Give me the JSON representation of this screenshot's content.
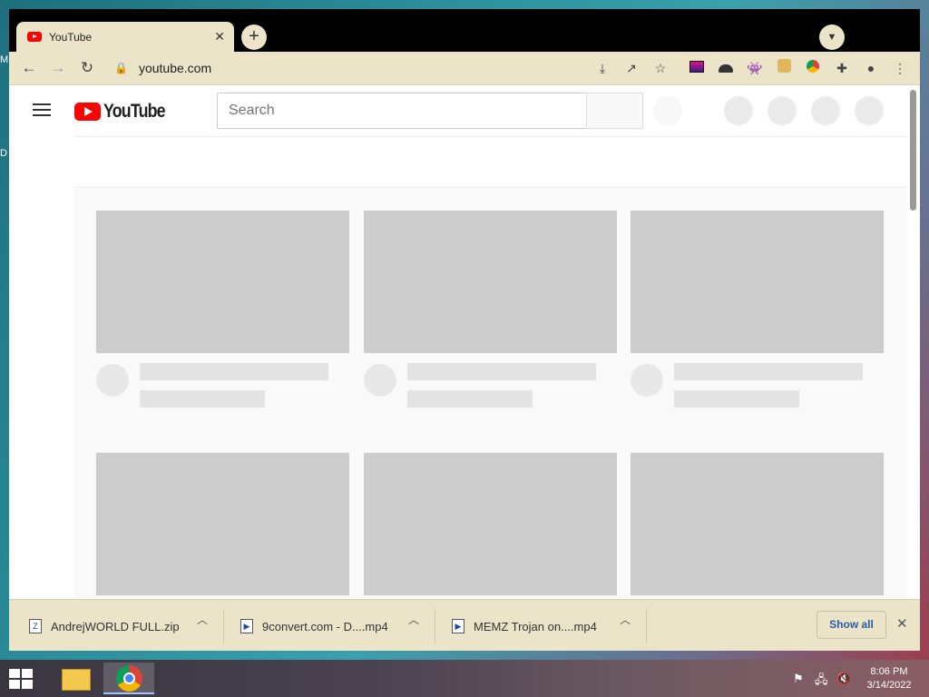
{
  "desktop": {
    "edge_letters": [
      "M",
      "D"
    ]
  },
  "browser": {
    "tab": {
      "title": "YouTube",
      "close": "✕",
      "favicon_icon": "youtube-favicon-icon"
    },
    "new_tab_label": "+",
    "tab_search_icon": "chevron-down-icon",
    "toolbar": {
      "back": "←",
      "forward": "→",
      "reload": "↻",
      "url": "youtube.com",
      "lock_icon": "lock-icon",
      "extensions": [
        "install-icon",
        "share-icon",
        "star-icon",
        "extension-tv-icon",
        "extension-hat-icon",
        "extension-alien-icon",
        "extension-doge-icon",
        "extension-chrome-icon",
        "puzzle-icon",
        "profile-icon",
        "kebab-menu-icon"
      ]
    },
    "accent_color": "#ece4c8"
  },
  "youtube": {
    "logo_text": "YouTube",
    "search_placeholder": "Search",
    "brand_color": "#ff0000"
  },
  "downloads": {
    "items": [
      {
        "name": "AndrejWORLD FULL.zip",
        "icon": "zip-file-icon"
      },
      {
        "name": "9convert.com - D....mp4",
        "icon": "video-file-icon"
      },
      {
        "name": "MEMZ Trojan on....mp4",
        "icon": "video-file-icon"
      }
    ],
    "show_all": "Show all",
    "close": "✕"
  },
  "taskbar": {
    "apps": [
      "file-explorer-icon",
      "chrome-icon"
    ],
    "clock_time": "8:06 PM",
    "clock_date": "3/14/2022"
  }
}
